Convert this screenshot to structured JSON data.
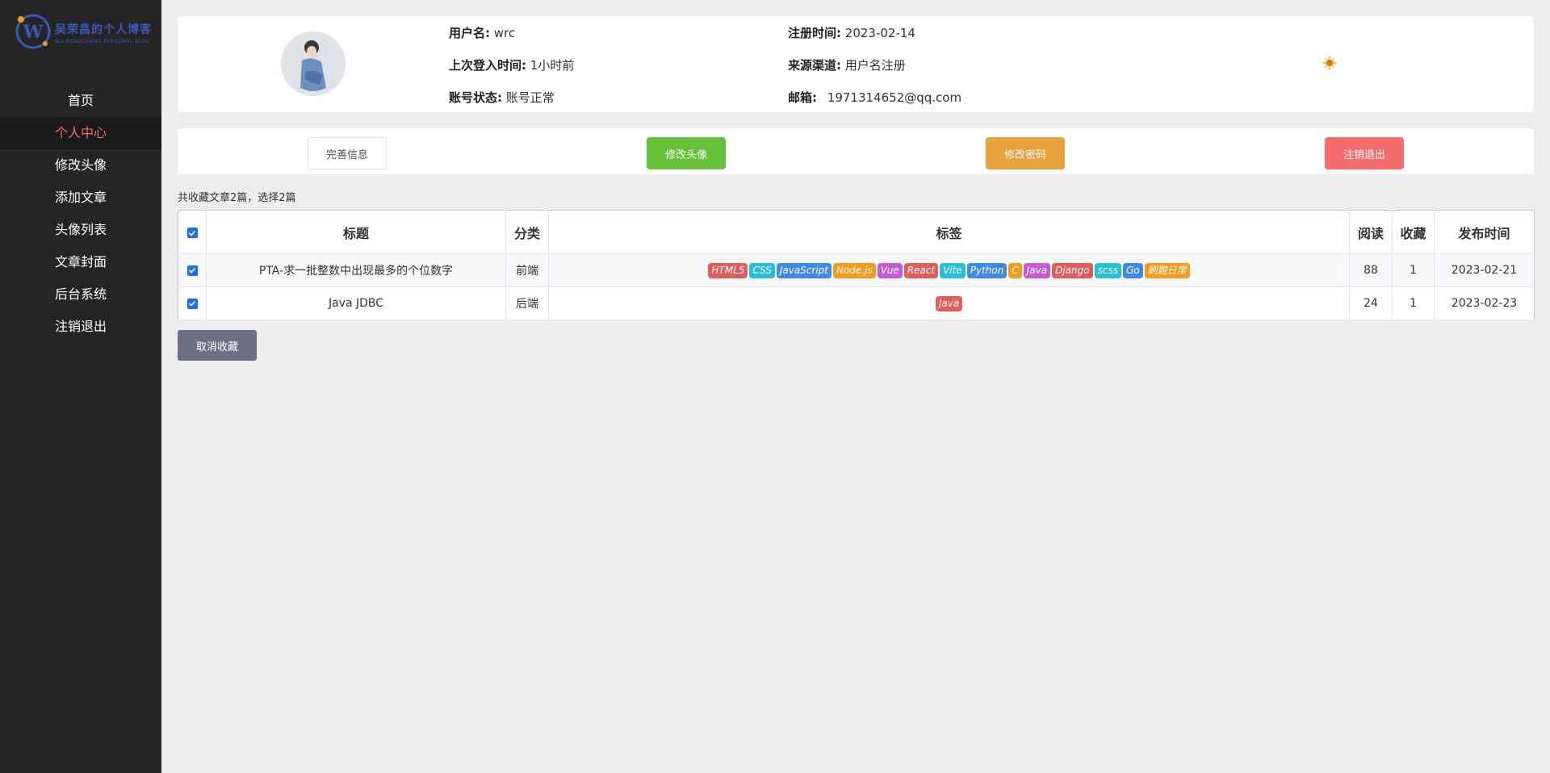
{
  "logo": {
    "text": "吴荣昌的个人博客",
    "sub": "WU RONGCHANG PERSONAL BLOG",
    "letter": "W"
  },
  "sidebar": {
    "items": [
      {
        "label": "首页",
        "active": false
      },
      {
        "label": "个人中心",
        "active": true
      },
      {
        "label": "修改头像",
        "active": false
      },
      {
        "label": "添加文章",
        "active": false
      },
      {
        "label": "头像列表",
        "active": false
      },
      {
        "label": "文章封面",
        "active": false
      },
      {
        "label": "后台系统",
        "active": false
      },
      {
        "label": "注销退出",
        "active": false
      }
    ]
  },
  "profile": {
    "username_label": "用户名:",
    "username": "wrc",
    "register_label": "注册时间:",
    "register": "2023-02-14",
    "last_login_label": "上次登入时间:",
    "last_login": "1小时前",
    "source_label": "来源渠道:",
    "source": "用户名注册",
    "status_label": "账号状态:",
    "status": "账号正常",
    "email_label": "邮箱:",
    "email": "1971314652@qq.com"
  },
  "actions": {
    "complete": "完善信息",
    "avatar": "修改头像",
    "password": "修改密码",
    "logout": "注销退出"
  },
  "summary": "共收藏文章2篇，选择2篇",
  "table": {
    "headers": [
      "标题",
      "分类",
      "标签",
      "阅读",
      "收藏",
      "发布时间"
    ],
    "rows": [
      {
        "title": "PTA-求一批整数中出现最多的个位数字",
        "category": "前端",
        "tags": [
          {
            "name": "HTML5",
            "color": "#e05d5b"
          },
          {
            "name": "CSS",
            "color": "#26bfd4"
          },
          {
            "name": "JavaScript",
            "color": "#3f8ae6"
          },
          {
            "name": "Node.js",
            "color": "#f59b1b"
          },
          {
            "name": "Vue",
            "color": "#c55bd6"
          },
          {
            "name": "React",
            "color": "#e05d5b"
          },
          {
            "name": "Vite",
            "color": "#26bfd4"
          },
          {
            "name": "Python",
            "color": "#3f8ae6"
          },
          {
            "name": "C",
            "color": "#f59b1b"
          },
          {
            "name": "Java",
            "color": "#c55bd6"
          },
          {
            "name": "Django",
            "color": "#e05d5b"
          },
          {
            "name": "scss",
            "color": "#26bfd4"
          },
          {
            "name": "Go",
            "color": "#3f8ae6"
          },
          {
            "name": "刷题日常",
            "color": "#f59b1b"
          }
        ],
        "reads": "88",
        "favs": "1",
        "date": "2023-02-21"
      },
      {
        "title": "Java JDBC",
        "category": "后端",
        "tags": [
          {
            "name": "Java",
            "color": "#e05d5b"
          }
        ],
        "reads": "24",
        "favs": "1",
        "date": "2023-02-23"
      }
    ]
  },
  "cancel_fav": "取消收藏"
}
